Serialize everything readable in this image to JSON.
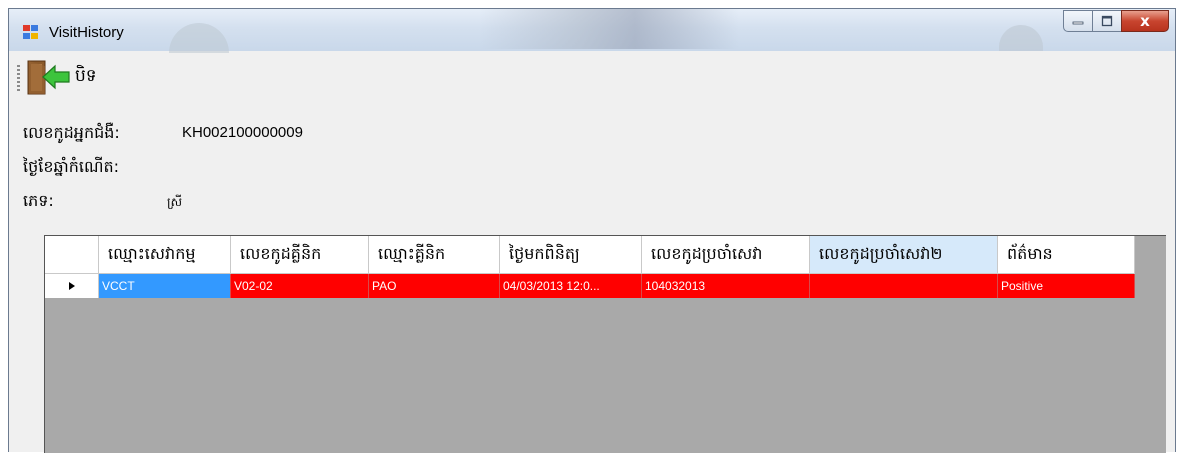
{
  "window": {
    "title": "VisitHistory",
    "controls": {
      "minimize": "minimize",
      "maximize": "maximize",
      "close": "x"
    }
  },
  "toolbar": {
    "exit_label": "បិទ"
  },
  "patient": {
    "code_label": "លេខកូដអ្នកជំងឺ:",
    "code_value": "KH002100000009",
    "dob_label": "ថ្ងៃខែឆ្នាំកំណើត:",
    "dob_value": "",
    "sex_label": "ភេទ:",
    "sex_value": "ស្រី"
  },
  "grid": {
    "columns": [
      "ឈ្មោះសេវាកម្ម",
      "លេខកូដគ្លីនិក",
      "ឈ្មោះគ្លីនិក",
      "ថ្ងៃមកពិនិត្យ",
      "លេខកូដប្រចាំសេវា",
      "លេខកូដប្រចាំសេវា២",
      "ព័ត៌មាន"
    ],
    "rows": [
      {
        "current": true,
        "cells": [
          "VCCT",
          "V02-02",
          "PAO",
          "04/03/2013 12:0...",
          "104032013",
          "",
          "Positive"
        ]
      }
    ]
  },
  "colors": {
    "row_highlight": "#ff0000",
    "current_cell": "#3399ff",
    "selected_header": "#d6e9fa",
    "grid_background": "#a9a9a9"
  },
  "icons": {
    "app": "app-grid-icon",
    "exit": "exit-door-arrow-icon",
    "row_pointer": "row-pointer-icon"
  }
}
